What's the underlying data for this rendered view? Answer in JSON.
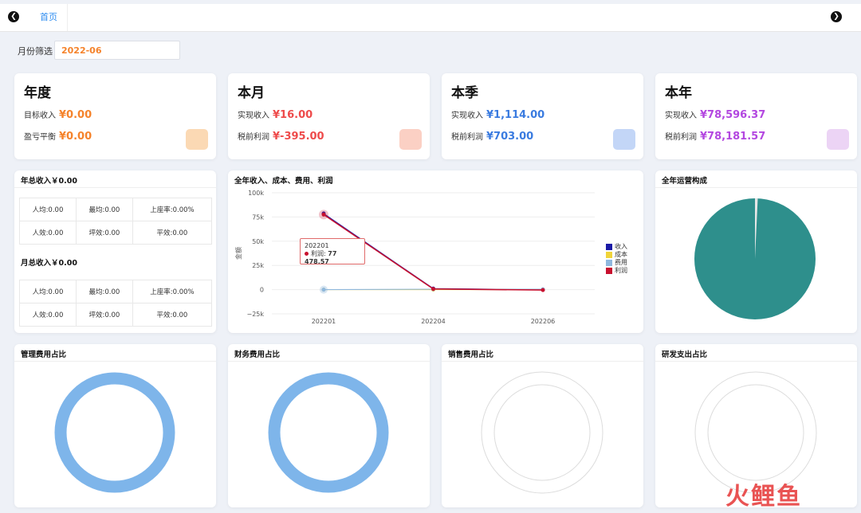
{
  "topbar": {
    "tab": "首页"
  },
  "filter": {
    "label": "月份筛选",
    "value": "2022-06"
  },
  "kpis": [
    {
      "title": "年度",
      "rows": [
        {
          "label": "目标收入",
          "value": "¥0.00"
        },
        {
          "label": "盈亏平衡",
          "value": "¥0.00"
        }
      ],
      "color": "#f5832b"
    },
    {
      "title": "本月",
      "rows": [
        {
          "label": "实现收入",
          "value": "¥16.00"
        },
        {
          "label": "税前利润",
          "value": "¥-395.00"
        }
      ],
      "color": "#ee4b4b"
    },
    {
      "title": "本季",
      "rows": [
        {
          "label": "实现收入",
          "value": "¥1,114.00"
        },
        {
          "label": "税前利润",
          "value": "¥703.00"
        }
      ],
      "color": "#3a7be0"
    },
    {
      "title": "本年",
      "rows": [
        {
          "label": "实现收入",
          "value": "¥78,596.37"
        },
        {
          "label": "税前利润",
          "value": "¥78,181.57"
        }
      ],
      "color": "#b347e0"
    }
  ],
  "stats": {
    "year_title": "年总收入￥0.00",
    "year_rows": [
      [
        "人均:0.00",
        "最均:0.00",
        "上座率:0.00%"
      ],
      [
        "人效:0.00",
        "坪效:0.00",
        "平效:0.00"
      ]
    ],
    "month_title": "月总收入￥0.00",
    "month_rows": [
      [
        "人均:0.00",
        "最均:0.00",
        "上座率:0.00%"
      ],
      [
        "人效:0.00",
        "坪效:0.00",
        "平效:0.00"
      ]
    ]
  },
  "panels": {
    "composition": "全年运营构成",
    "mgmt": "管理费用占比",
    "finance": "财务费用占比",
    "sales": "销售费用占比",
    "rnd": "研发支出占比"
  },
  "chart_data": {
    "type": "line",
    "title": "全年收入、成本、费用、利润",
    "ylabel": "金额",
    "xlabel": "",
    "x": [
      "202201",
      "202204",
      "202206"
    ],
    "ylim": [
      -25000,
      100000
    ],
    "yticks": [
      "100k",
      "75k",
      "50k",
      "25k",
      "0",
      "−25k"
    ],
    "yvalues": [
      100000,
      75000,
      50000,
      25000,
      0,
      -25000
    ],
    "series": [
      {
        "name": "收入",
        "color": "#1a1aa6",
        "values": [
          78596.37,
          1114,
          16
        ]
      },
      {
        "name": "成本",
        "color": "#f0d43a",
        "values": [
          0,
          0,
          0
        ]
      },
      {
        "name": "费用",
        "color": "#8fb8de",
        "values": [
          0,
          411,
          411
        ]
      },
      {
        "name": "利润",
        "color": "#c8102e",
        "values": [
          77478.57,
          703,
          -395
        ]
      }
    ],
    "tooltip": {
      "x": "202201",
      "label": "利润:",
      "value": "77 478.57"
    },
    "legend": "right"
  },
  "composition_pie": {
    "slices": [
      0.99,
      0.01
    ],
    "colors": [
      "#2e8f8c",
      "#e6e6e6"
    ]
  },
  "ring_colors": {
    "filled": "#7eb5ea",
    "empty": "#dcdcdc"
  },
  "watermark": "火鲤鱼"
}
